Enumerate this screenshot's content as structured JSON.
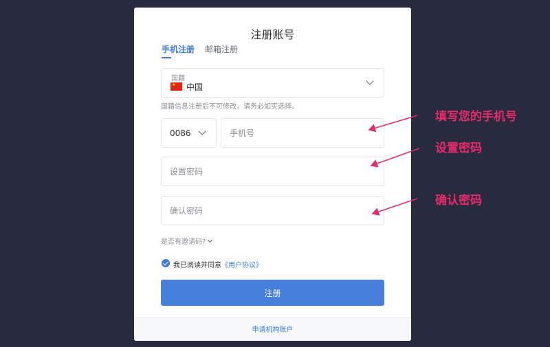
{
  "form": {
    "title": "注册账号",
    "tabs": [
      {
        "label": "手机注册",
        "active": true
      },
      {
        "label": "邮箱注册",
        "active": false
      }
    ],
    "nationality": {
      "label": "国籍",
      "value": "中国",
      "flag": "china-flag-icon"
    },
    "nationality_hint": "国籍信息注册后不可修改，请务必如实选择。",
    "country_code": "0086",
    "phone_placeholder": "手机号",
    "password_placeholder": "设置密码",
    "confirm_placeholder": "确认密码",
    "invite_toggle": "是否有邀请码?",
    "agreement": {
      "checked": true,
      "text": "我已阅读并同意",
      "link": "《用户协议》"
    },
    "submit_label": "注册",
    "footer_link": "申请机构账户"
  },
  "annotations": {
    "phone": "填写您的手机号",
    "password": "设置密码",
    "confirm": "确认密码"
  },
  "colors": {
    "background": "#272b3d",
    "accent": "#3d7be0",
    "button": "#4680dc",
    "annotation": "#e52b6a"
  }
}
